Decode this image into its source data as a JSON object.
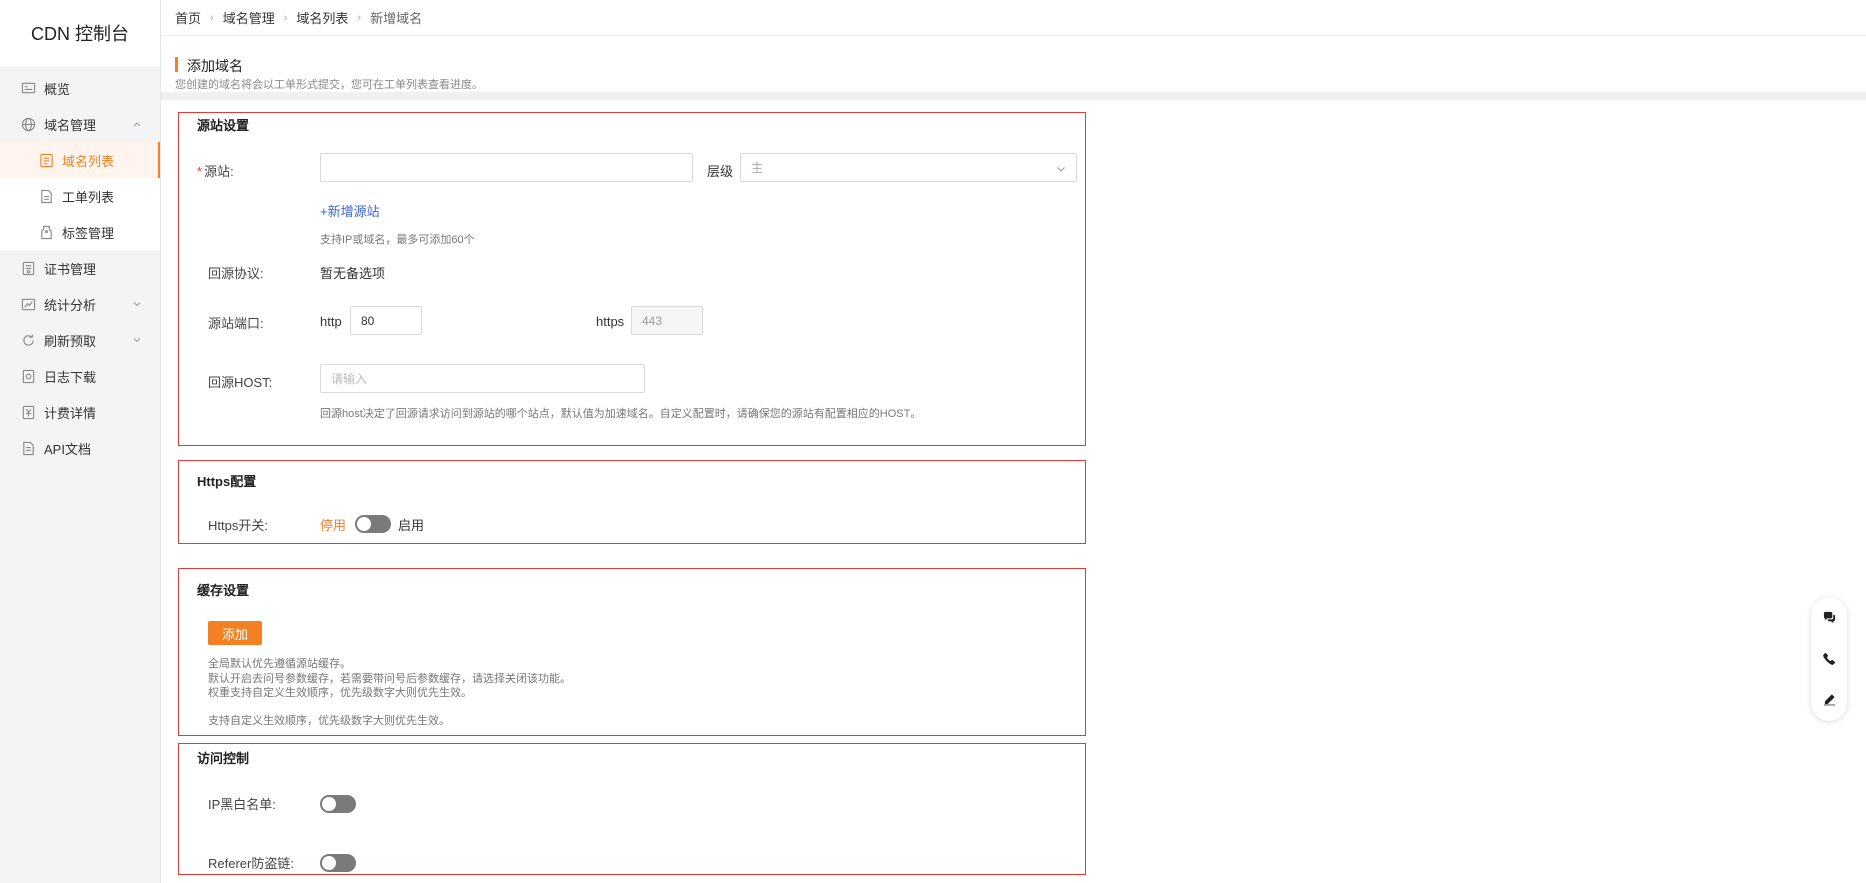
{
  "app": {
    "title": "CDN 控制台"
  },
  "sidebar": {
    "items": [
      {
        "label": "概览",
        "icon": "overview-icon"
      },
      {
        "label": "域名管理",
        "icon": "globe-icon"
      },
      {
        "label": "证书管理",
        "icon": "certificate-icon"
      },
      {
        "label": "统计分析",
        "icon": "chart-icon"
      },
      {
        "label": "刷新预取",
        "icon": "refresh-icon"
      },
      {
        "label": "日志下载",
        "icon": "log-icon"
      },
      {
        "label": "计费详情",
        "icon": "billing-icon"
      },
      {
        "label": "API文档",
        "icon": "document-icon"
      }
    ],
    "sub_items": [
      {
        "label": "域名列表",
        "icon": "list-icon"
      },
      {
        "label": "工单列表",
        "icon": "ticket-icon"
      },
      {
        "label": "标签管理",
        "icon": "tag-icon"
      }
    ],
    "accent": "#f48024"
  },
  "breadcrumb": [
    "首页",
    "域名管理",
    "域名列表",
    "新增域名"
  ],
  "page": {
    "title": "添加域名",
    "desc": "您创建的域名将会以工单形式提交，您可在工单列表查看进度。"
  },
  "origin": {
    "title": "源站设置",
    "source_label": "源站:",
    "source_value": "",
    "level_label": "层级",
    "level_value": "主",
    "add_link": "+新增源站",
    "hint": "支持IP或域名，最多可添加60个",
    "protocol_label": "回源协议:",
    "protocol_value": "暂无备选项",
    "port_label": "源站端口:",
    "http_label": "http",
    "http_value": "80",
    "https_label": "https",
    "https_value": "443",
    "host_label": "回源HOST:",
    "host_placeholder": "请输入",
    "host_hint": "回源host决定了回源请求访问到源站的哪个站点，默认值为加速域名。自定义配置时，请确保您的源站有配置相应的HOST。"
  },
  "https_config": {
    "title": "Https配置",
    "switch_label": "Https开关:",
    "off_label": "停用",
    "on_label": "启用",
    "enabled": false
  },
  "cache": {
    "title": "缓存设置",
    "add_label": "添加",
    "notes": [
      "全局默认优先遵循源站缓存。",
      "默认开启去问号参数缓存，若需要带问号后参数缓存，请选择关闭该功能。",
      "权重支持自定义生效顺序，优先级数字大则优先生效。"
    ],
    "note_extra": "支持自定义生效顺序，优先级数字大则优先生效。"
  },
  "access": {
    "title": "访问控制",
    "ip_label": "IP黑白名单:",
    "ip_enabled": false,
    "referer_label": "Referer防盗链:",
    "referer_enabled": false
  },
  "float_tools": [
    "chat-icon",
    "phone-icon",
    "edit-icon"
  ]
}
